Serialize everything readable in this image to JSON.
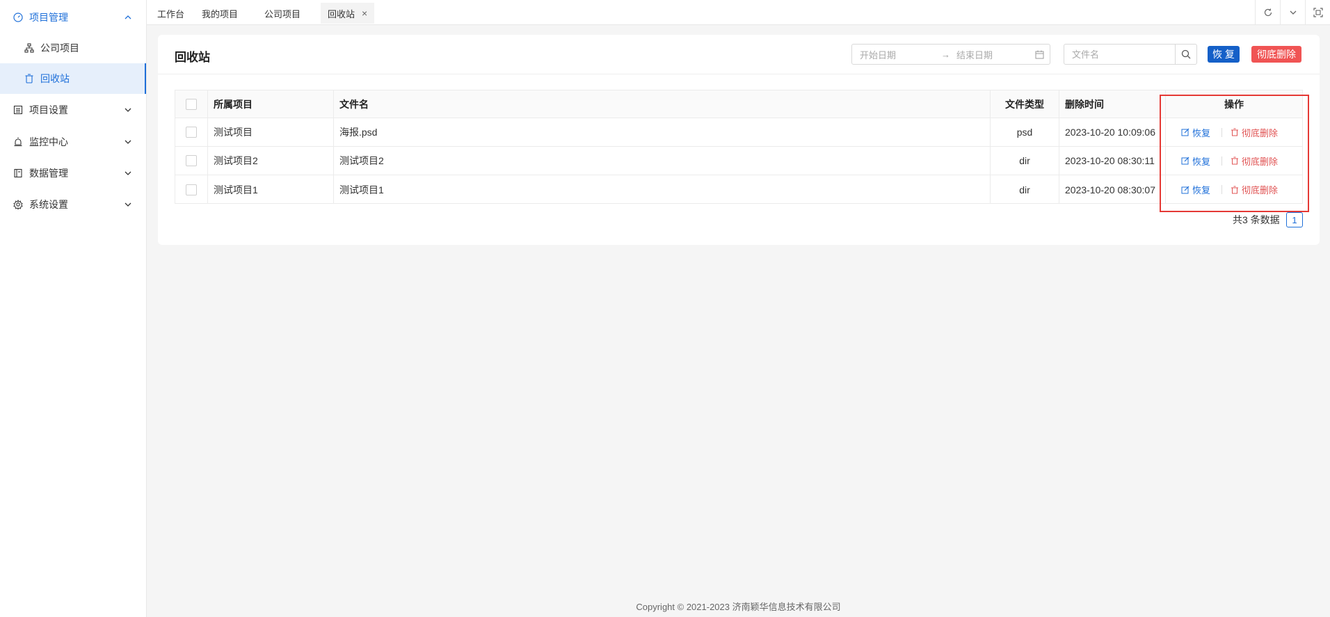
{
  "sidebar": {
    "items": [
      {
        "label": "项目管理",
        "icon": "dashboard-icon",
        "expanded": true
      },
      {
        "label": "公司项目",
        "icon": "org-tree-icon"
      },
      {
        "label": "回收站",
        "icon": "trash-icon",
        "selected": true
      },
      {
        "label": "项目设置",
        "icon": "list-icon"
      },
      {
        "label": "监控中心",
        "icon": "alarm-icon"
      },
      {
        "label": "数据管理",
        "icon": "book-icon"
      },
      {
        "label": "系统设置",
        "icon": "gear-icon"
      }
    ]
  },
  "tabs": [
    {
      "label": "工作台"
    },
    {
      "label": "我的项目"
    },
    {
      "label": "公司项目"
    },
    {
      "label": "回收站",
      "active": true,
      "close": "×"
    }
  ],
  "card": {
    "title": "回收站",
    "start_placeholder": "开始日期",
    "range_arrow": "→",
    "end_placeholder": "结束日期",
    "search_placeholder": "文件名",
    "restore_label": "恢 复",
    "delete_label": "彻底删除"
  },
  "table": {
    "headers": {
      "project": "所属项目",
      "filename": "文件名",
      "filetype": "文件类型",
      "deleted_at": "删除时间",
      "actions": "操作"
    },
    "rows": [
      {
        "project": "测试项目",
        "filename": "海报.psd",
        "filetype": "psd",
        "deleted_at": "2023-10-20 10:09:06"
      },
      {
        "project": "测试项目2",
        "filename": "测试项目2",
        "filetype": "dir",
        "deleted_at": "2023-10-20 08:30:11"
      },
      {
        "project": "测试项目1",
        "filename": "测试项目1",
        "filetype": "dir",
        "deleted_at": "2023-10-20 08:30:07"
      }
    ],
    "row_restore": "恢复",
    "row_delete": "彻底删除"
  },
  "pagination": {
    "total": "共3 条数据",
    "current_page": "1"
  },
  "footer": "Copyright © 2021-2023 济南颖华信息技术有限公司",
  "colors": {
    "primary": "#1e6fd9",
    "danger": "#f05454",
    "highlight": "#e53935"
  }
}
